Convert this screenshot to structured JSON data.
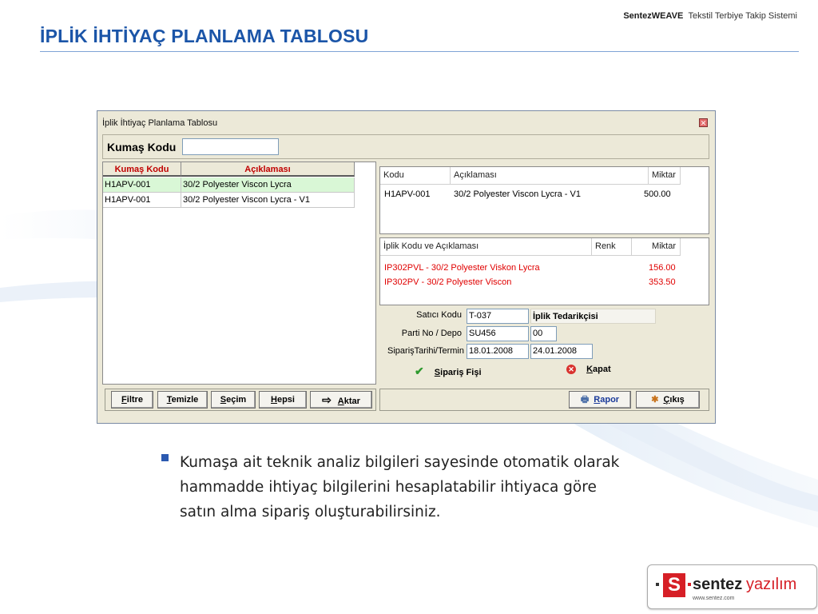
{
  "header": {
    "brand_bold": "SentezWEAVE",
    "brand_rest": "Tekstil Terbiye Takip Sistemi",
    "title": "İPLİK İHTİYAÇ PLANLAMA TABLOSU"
  },
  "window": {
    "title": "İplik İhtiyaç Planlama Tablosu",
    "close_glyph": "✕",
    "search_label": "Kumaş Kodu",
    "search_value": ""
  },
  "left_grid": {
    "headers": [
      "Kumaş Kodu",
      "Açıklaması"
    ],
    "rows": [
      {
        "code": "H1APV-001",
        "desc": "30/2 Polyester Viscon Lycra"
      },
      {
        "code": "H1APV-001",
        "desc": "30/2 Polyester Viscon Lycra - V1"
      }
    ]
  },
  "top_panel": {
    "headers": [
      "Kodu",
      "Açıklaması",
      "Miktar"
    ],
    "rows": [
      {
        "code": "H1APV-001",
        "desc": "30/2 Polyester Viscon Lycra - V1",
        "qty": "500.00"
      }
    ]
  },
  "yarn_panel": {
    "headers": [
      "İplik Kodu ve Açıklaması",
      "Renk",
      "Miktar"
    ],
    "rows": [
      {
        "desc": "IP302PVL - 30/2 Polyester Viskon Lycra",
        "color": "",
        "qty": "156.00"
      },
      {
        "desc": "IP302PV - 30/2 Polyester Viscon",
        "color": "",
        "qty": "353.50"
      }
    ]
  },
  "form": {
    "supplier_label": "Satıcı Kodu",
    "supplier_code": "T-037",
    "supplier_name": "İplik Tedarikçisi",
    "lot_label": "Parti No / Depo",
    "lot_no": "SU456",
    "depot": "00",
    "date_label": "SiparişTarihi/Termin",
    "order_date": "18.01.2008",
    "due_date": "24.01.2008",
    "order_btn_first": "S",
    "order_btn_rest": "ipariş Fişi",
    "close_btn_first": "K",
    "close_btn_rest": "apat"
  },
  "toolbar": {
    "filter_first": "F",
    "filter_rest": "iltre",
    "clear_first": "T",
    "clear_rest": "emizle",
    "select_first": "S",
    "select_rest": "eçim",
    "all_first": "H",
    "all_rest": "epsi",
    "transfer_first": "A",
    "transfer_rest": "ktar",
    "report_first": "R",
    "report_rest": "apor",
    "exit_first": "Ç",
    "exit_rest": "ıkış"
  },
  "body_text": "Kumaşa ait teknik analiz bilgileri sayesinde otomatik olarak hammadde ihtiyaç bilgilerini hesaplatabilir ihtiyaca göre satın alma sipariş oluşturabilirsiniz.",
  "logo": {
    "letter": "S",
    "word_bold": "sentez",
    "word_light": "yazılım",
    "url": "www.sentez.com"
  },
  "colors": {
    "title_blue": "#1b55a8",
    "grid_header_red": "#c00000",
    "yarn_red": "#e00000",
    "selected_row": "#d9f7d6"
  }
}
